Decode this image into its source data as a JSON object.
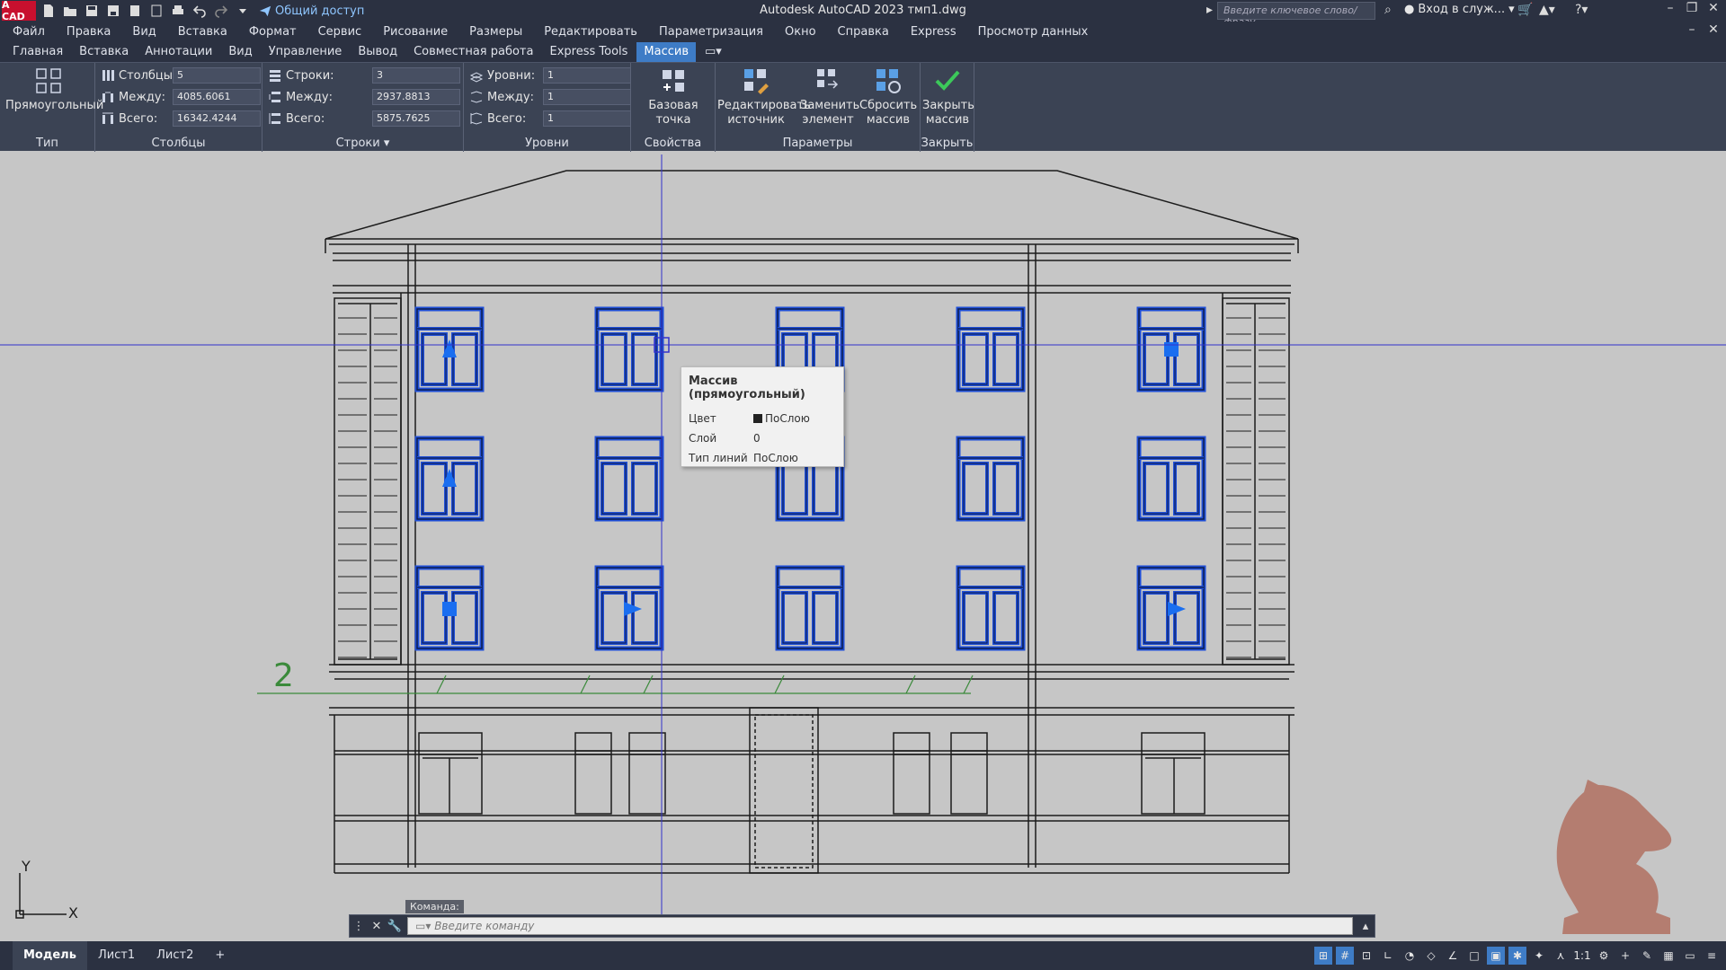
{
  "titlebar": {
    "logo": "A CAD",
    "share_label": "Общий доступ",
    "app_title": "Autodesk AutoCAD 2023    тмп1.dwg",
    "search_placeholder": "Введите ключевое слово/фразу",
    "login_label": "Вход в служ..."
  },
  "menu": [
    "Файл",
    "Правка",
    "Вид",
    "Вставка",
    "Формат",
    "Сервис",
    "Рисование",
    "Размеры",
    "Редактировать",
    "Параметризация",
    "Окно",
    "Справка",
    "Express",
    "Просмотр данных"
  ],
  "ribbon_tabs": [
    "Главная",
    "Вставка",
    "Аннотации",
    "Вид",
    "Управление",
    "Вывод",
    "Совместная работа",
    "Express Tools",
    "Массив"
  ],
  "ribbon_active_tab": "Массив",
  "ribbon": {
    "type_panel": {
      "button": "Прямоугольный",
      "title": "Тип"
    },
    "columns_panel": {
      "title": "Столбцы",
      "count_label": "Столбцы:",
      "count_value": "5",
      "between_label": "Между:",
      "between_value": "4085.6061",
      "total_label": "Всего:",
      "total_value": "16342.4244"
    },
    "rows_panel": {
      "title": "Строки",
      "count_label": "Строки:",
      "count_value": "3",
      "between_label": "Между:",
      "between_value": "2937.8813",
      "total_label": "Всего:",
      "total_value": "5875.7625"
    },
    "levels_panel": {
      "title": "Уровни",
      "count_label": "Уровни:",
      "count_value": "1",
      "between_label": "Между:",
      "between_value": "1",
      "total_label": "Всего:",
      "total_value": "1"
    },
    "properties_panel": {
      "title": "Свойства",
      "base_point": "Базовая точка"
    },
    "parameters_panel": {
      "title": "Параметры",
      "edit_source_line1": "Редактировать",
      "edit_source_line2": "источник",
      "replace_line1": "Заменить",
      "replace_line2": "элемент",
      "reset_line1": "Сбросить",
      "reset_line2": "массив"
    },
    "close_panel": {
      "title": "Закрыть",
      "close_line1": "Закрыть",
      "close_line2": "массив"
    }
  },
  "tooltip": {
    "title": "Массив (прямоугольный)",
    "rows": [
      {
        "key": "Цвет",
        "value": "ПоСлою"
      },
      {
        "key": "Слой",
        "value": "0"
      },
      {
        "key": "Тип линий",
        "value": "ПоСлою"
      }
    ]
  },
  "drawing": {
    "annotation_number": "2",
    "ucs_x": "X",
    "ucs_y": "Y"
  },
  "command": {
    "label": "Команда:",
    "placeholder": "Введите команду"
  },
  "layout_tabs": [
    "Модель",
    "Лист1",
    "Лист2"
  ],
  "status": {
    "scale": "1:1"
  },
  "colors": {
    "selection": "#1f4fd8",
    "grip": "#1a6ef0",
    "crosshair": "#3333cc",
    "annotation": "#3a8a3a",
    "ribbon_bg": "#3b4354",
    "accent": "#3e7cc6",
    "watermark": "#b07060"
  }
}
